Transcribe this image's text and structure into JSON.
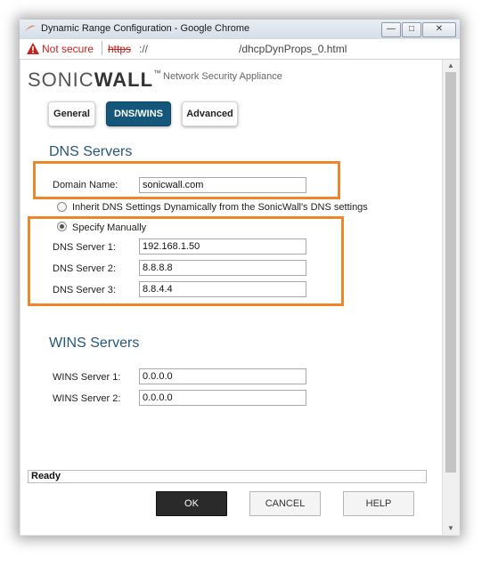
{
  "window": {
    "title": "Dynamic Range Configuration - Google Chrome",
    "minimize_glyph": "—",
    "restore_glyph": "□",
    "close_glyph": "✕"
  },
  "address": {
    "not_secure": "Not secure",
    "scheme": "https",
    "after_scheme": "://",
    "path": "/dhcpDynProps_0.html"
  },
  "branding": {
    "logo_prefix": "SONIC",
    "logo_suffix": "WALL",
    "trademark": "™",
    "tagline": "Network Security Appliance"
  },
  "tabs": [
    {
      "label": "General",
      "active": false
    },
    {
      "label": "DNS/WINS",
      "active": true
    },
    {
      "label": "Advanced",
      "active": false
    }
  ],
  "dns": {
    "heading": "DNS Servers",
    "domain_label": "Domain Name:",
    "domain_value": "sonicwall.com",
    "inherit_label": "Inherit DNS Settings Dynamically from the SonicWall's DNS settings",
    "manual_label": "Specify Manually",
    "server1_label": "DNS Server 1:",
    "server1_value": "192.168.1.50",
    "server2_label": "DNS Server 2:",
    "server2_value": "8.8.8.8",
    "server3_label": "DNS Server 3:",
    "server3_value": "8.8.4.4"
  },
  "wins": {
    "heading": "WINS Servers",
    "server1_label": "WINS Server 1:",
    "server1_value": "0.0.0.0",
    "server2_label": "WINS Server 2:",
    "server2_value": "0.0.0.0"
  },
  "status": {
    "text": "Ready"
  },
  "buttons": {
    "ok": "OK",
    "cancel": "CANCEL",
    "help": "HELP"
  },
  "colors": {
    "highlight": "#f0862a",
    "active_tab": "#15577a",
    "heading": "#26577a"
  }
}
